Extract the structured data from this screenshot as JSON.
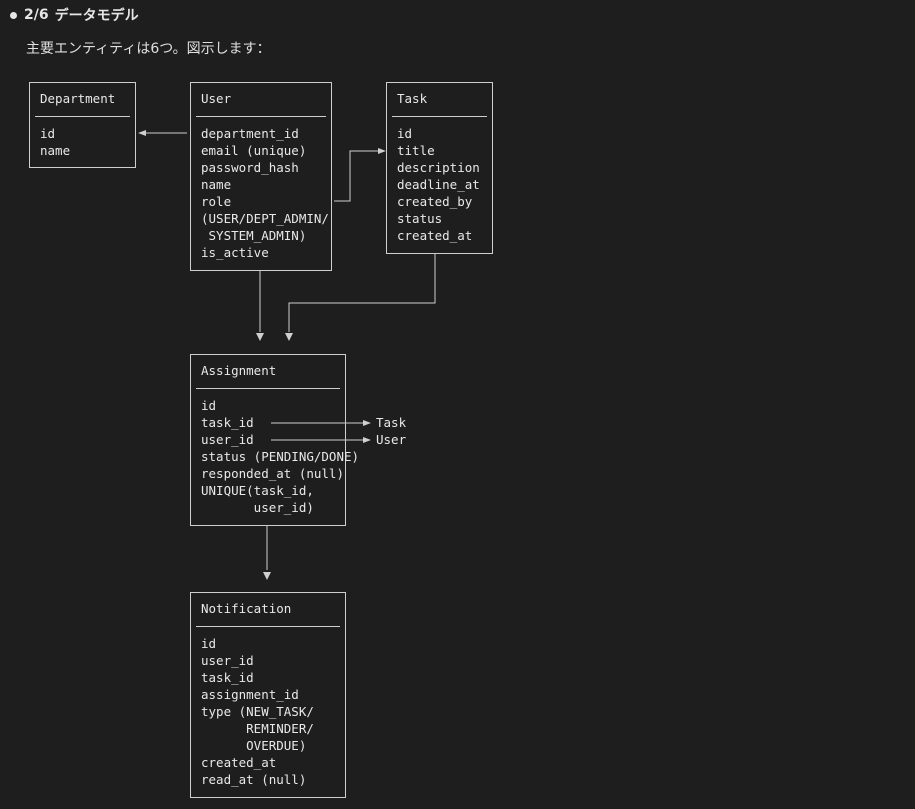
{
  "header": {
    "step": "2/6",
    "title": "データモデル"
  },
  "intro": "主要エンティティは6つ。図示します：",
  "entities": {
    "department": {
      "title": "Department",
      "fields": "id\nname"
    },
    "user": {
      "title": "User",
      "fields": "department_id\nemail (unique)\npassword_hash\nname\nrole\n(USER/DEPT_ADMIN/\n SYSTEM_ADMIN)\nis_active"
    },
    "task": {
      "title": "Task",
      "fields": "id\ntitle\ndescription\ndeadline_at\ncreated_by\nstatus\ncreated_at"
    },
    "assignment": {
      "title": "Assignment",
      "fields": "id\ntask_id\nuser_id\nstatus (PENDING/DONE)\nresponded_at (null)\nUNIQUE(task_id,\n       user_id)"
    },
    "notification": {
      "title": "Notification",
      "fields": "id\nuser_id\ntask_id\nassignment_id\ntype (NEW_TASK/\n      REMINDER/\n      OVERDUE)\ncreated_at\nread_at (null)"
    }
  },
  "annotations": {
    "task_ref": "Task",
    "user_ref": "User"
  }
}
